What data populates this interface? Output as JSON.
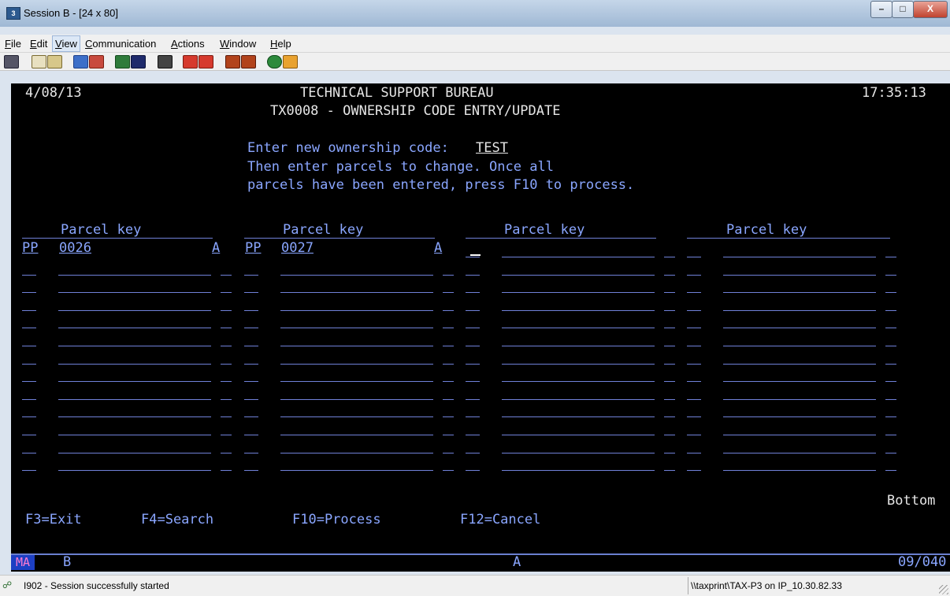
{
  "window": {
    "title": "Session B - [24 x 80]",
    "controls": {
      "minimize": "–",
      "maximize": "□",
      "close": "X"
    }
  },
  "menu": [
    {
      "label": "File",
      "u": "F",
      "rest": "ile"
    },
    {
      "label": "Edit",
      "u": "E",
      "rest": "dit"
    },
    {
      "label": "View",
      "u": "V",
      "rest": "iew"
    },
    {
      "label": "Communication",
      "u": "C",
      "rest": "ommunication"
    },
    {
      "label": "Actions",
      "u": "A",
      "rest": "ctions"
    },
    {
      "label": "Window",
      "u": "W",
      "rest": "indow"
    },
    {
      "label": "Help",
      "u": "H",
      "rest": "elp"
    }
  ],
  "toolbar_icons": [
    "print-screen-icon",
    "copy-icon",
    "paste-icon",
    "send-file-icon",
    "receive-file-icon",
    "display-icon",
    "keypad-icon",
    "macro-icon",
    "record-macro-icon",
    "stop-macro-icon",
    "play-macro-icon",
    "run-macro-icon",
    "color-icon",
    "customize-icon"
  ],
  "screen": {
    "date": "4/08/13",
    "header": "TECHNICAL SUPPORT BUREAU",
    "time": "17:35:13",
    "program": "TX0008 - OWNERSHIP CODE ENTRY/UPDATE",
    "prompt_label": "Enter new ownership code:",
    "ownership_code": "TEST",
    "instruction_1": "Then enter parcels to change. Once all",
    "instruction_2": "parcels have been entered, press F10 to process.",
    "column_header": "Parcel key",
    "entries": [
      {
        "prefix": "PP",
        "key": "0026",
        "flag": "A"
      },
      {
        "prefix": "PP",
        "key": "0027",
        "flag": "A"
      }
    ],
    "bottom": "Bottom",
    "fkeys": {
      "f3": "F3=Exit",
      "f4": "F4=Search",
      "f10": "F10=Process",
      "f12": "F12=Cancel"
    }
  },
  "oia": {
    "mark": "MA",
    "session": "B",
    "input_mode": "A",
    "cursor_pos": "09/040"
  },
  "statusbar": {
    "message": "I902 - Session successfully started",
    "host": "\\\\taxprint\\TAX-P3 on IP_10.30.82.33"
  }
}
